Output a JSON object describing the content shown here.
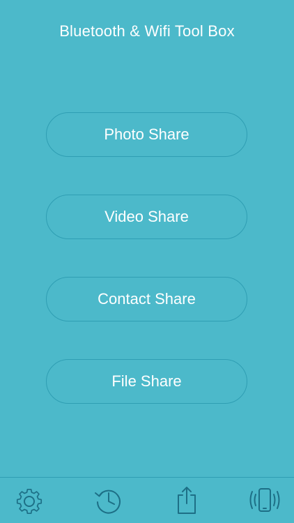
{
  "header": {
    "title": "Bluetooth & Wifi Tool Box"
  },
  "actions": [
    {
      "label": "Photo Share"
    },
    {
      "label": "Video Share"
    },
    {
      "label": "Contact Share"
    },
    {
      "label": "File Share"
    }
  ],
  "tabbar": {
    "items": [
      {
        "icon": "gear-icon"
      },
      {
        "icon": "history-icon"
      },
      {
        "icon": "share-icon"
      },
      {
        "icon": "vibrating-phone-icon"
      }
    ]
  },
  "colors": {
    "background": "#4cb9ca",
    "border": "#2f9eb3",
    "text": "#ffffff",
    "icon": "#1d6f86"
  }
}
